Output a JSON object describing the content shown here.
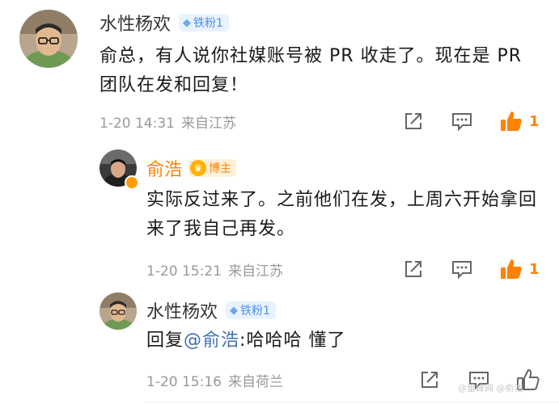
{
  "comments": [
    {
      "username": "水性杨欢",
      "fan_badge": "铁粉1",
      "text": "俞总，有人说你社媒账号被 PR 收走了。现在是 PR 团队在发和回复！",
      "time": "1-20 14:31",
      "location": "来自江苏",
      "likes": "1"
    },
    {
      "username": "俞浩",
      "host_badge": "博主",
      "text": "实际反过来了。之前他们在发，上周六开始拿回来了我自己再发。",
      "time": "1-20 15:21",
      "location": "来自江苏",
      "likes": "1"
    },
    {
      "username": "水性杨欢",
      "fan_badge": "铁粉1",
      "reply_prefix": "回复",
      "mention": "@俞浩",
      "reply_text": ":哈哈哈 懂了",
      "time": "1-20 15:16",
      "location": "来自荷兰",
      "likes": ""
    }
  ],
  "icons": {
    "share": "share-icon",
    "comment": "comment-icon",
    "like": "thumbs-up-icon",
    "verified": "verified-icon",
    "diamond": "diamond-icon",
    "crown": "crown-icon"
  },
  "colors": {
    "accent": "#ff8200",
    "fan_badge_bg": "#e9f2ff",
    "fan_badge_text": "#4a90e2",
    "mention": "#3d6fb0",
    "meta": "#999999"
  },
  "watermark": "@雷峰网 @俞浩"
}
